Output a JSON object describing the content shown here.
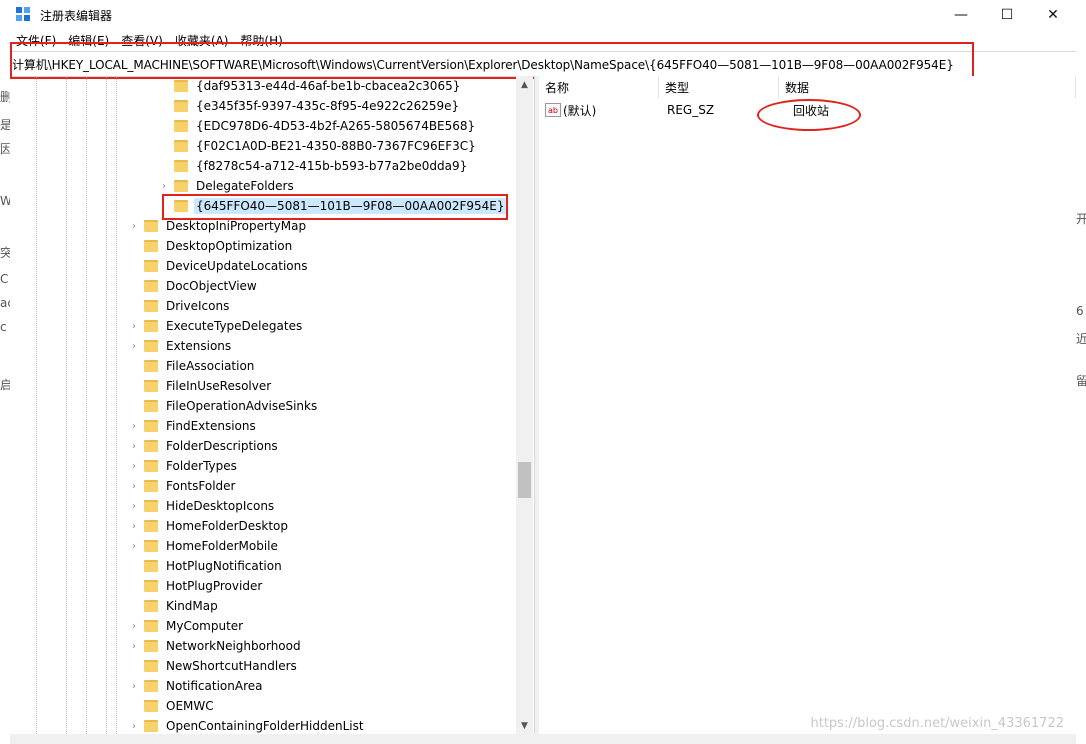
{
  "window": {
    "title": "注册表编辑器",
    "controls": {
      "minimize": "—",
      "maximize": "☐",
      "close": "✕"
    }
  },
  "menu": [
    "文件(F)",
    "编辑(E)",
    "查看(V)",
    "收藏夹(A)",
    "帮助(H)"
  ],
  "address": "计算机\\HKEY_LOCAL_MACHINE\\SOFTWARE\\Microsoft\\Windows\\CurrentVersion\\Explorer\\Desktop\\NameSpace\\{645FFO40—5081—101B—9F08—00AA002F954E}",
  "tree": {
    "nested_items": [
      {
        "label": "{daf95313-e44d-46af-be1b-cbacea2c3065}",
        "expandable": false
      },
      {
        "label": "{e345f35f-9397-435c-8f95-4e922c26259e}",
        "expandable": false
      },
      {
        "label": "{EDC978D6-4D53-4b2f-A265-5805674BE568}",
        "expandable": false
      },
      {
        "label": "{F02C1A0D-BE21-4350-88B0-7367FC96EF3C}",
        "expandable": false
      },
      {
        "label": "{f8278c54-a712-415b-b593-b77a2be0dda9}",
        "expandable": false
      },
      {
        "label": "DelegateFolders",
        "expandable": true
      },
      {
        "label": "{645FFO40—5081—101B—9F08—00AA002F954E}",
        "expandable": false,
        "selected": true
      }
    ],
    "items": [
      {
        "label": "DesktopIniPropertyMap",
        "expandable": true
      },
      {
        "label": "DesktopOptimization",
        "expandable": false
      },
      {
        "label": "DeviceUpdateLocations",
        "expandable": false
      },
      {
        "label": "DocObjectView",
        "expandable": false
      },
      {
        "label": "DriveIcons",
        "expandable": false
      },
      {
        "label": "ExecuteTypeDelegates",
        "expandable": true
      },
      {
        "label": "Extensions",
        "expandable": true
      },
      {
        "label": "FileAssociation",
        "expandable": false
      },
      {
        "label": "FileInUseResolver",
        "expandable": false
      },
      {
        "label": "FileOperationAdviseSinks",
        "expandable": false
      },
      {
        "label": "FindExtensions",
        "expandable": true
      },
      {
        "label": "FolderDescriptions",
        "expandable": true
      },
      {
        "label": "FolderTypes",
        "expandable": true
      },
      {
        "label": "FontsFolder",
        "expandable": true
      },
      {
        "label": "HideDesktopIcons",
        "expandable": true
      },
      {
        "label": "HomeFolderDesktop",
        "expandable": true
      },
      {
        "label": "HomeFolderMobile",
        "expandable": true
      },
      {
        "label": "HotPlugNotification",
        "expandable": false
      },
      {
        "label": "HotPlugProvider",
        "expandable": false
      },
      {
        "label": "KindMap",
        "expandable": false
      },
      {
        "label": "MyComputer",
        "expandable": true
      },
      {
        "label": "NetworkNeighborhood",
        "expandable": true
      },
      {
        "label": "NewShortcutHandlers",
        "expandable": false
      },
      {
        "label": "NotificationArea",
        "expandable": true
      },
      {
        "label": "OEMWC",
        "expandable": false
      },
      {
        "label": "OpenContainingFolderHiddenList",
        "expandable": true
      }
    ]
  },
  "columns": {
    "name": "名称",
    "type": "类型",
    "data": "数据"
  },
  "values": [
    {
      "name": "(默认)",
      "type": "REG_SZ",
      "data": "回收站"
    }
  ],
  "icons": {
    "expand": "›",
    "scroll_up": "▲",
    "scroll_down": "▼",
    "string_value": "ab"
  },
  "watermark": "https://blog.csdn.net/weixin_43361722",
  "background_fragments": [
    "删",
    "是",
    "因",
    "W",
    "突",
    "C",
    "ac",
    "c",
    "启",
    "开",
    "6",
    "近",
    "留"
  ],
  "colors": {
    "accent": "#1e73d2",
    "annotation_red": "#e0241b",
    "selection": "#cce8ff",
    "folder": "#f7d26a"
  }
}
